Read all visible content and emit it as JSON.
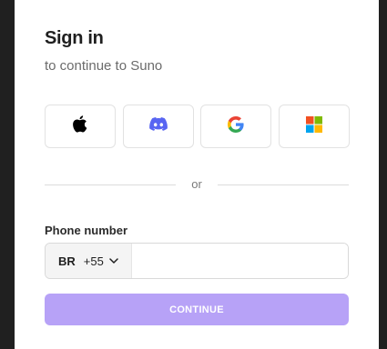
{
  "header": {
    "title": "Sign in",
    "subtitle": "to continue to Suno"
  },
  "social": [
    {
      "name": "apple",
      "icon": "apple-icon"
    },
    {
      "name": "discord",
      "icon": "discord-icon",
      "color": "#5865F2"
    },
    {
      "name": "google",
      "icon": "google-icon"
    },
    {
      "name": "microsoft",
      "icon": "microsoft-icon"
    }
  ],
  "divider": {
    "label": "or"
  },
  "phone": {
    "label": "Phone number",
    "country_code": "BR",
    "dial_code": "+55",
    "value": "",
    "placeholder": ""
  },
  "actions": {
    "continue_label": "CONTINUE",
    "continue_color": "#b7a2f7"
  },
  "colors": {
    "backdrop": "#202020",
    "card": "#ffffff"
  }
}
